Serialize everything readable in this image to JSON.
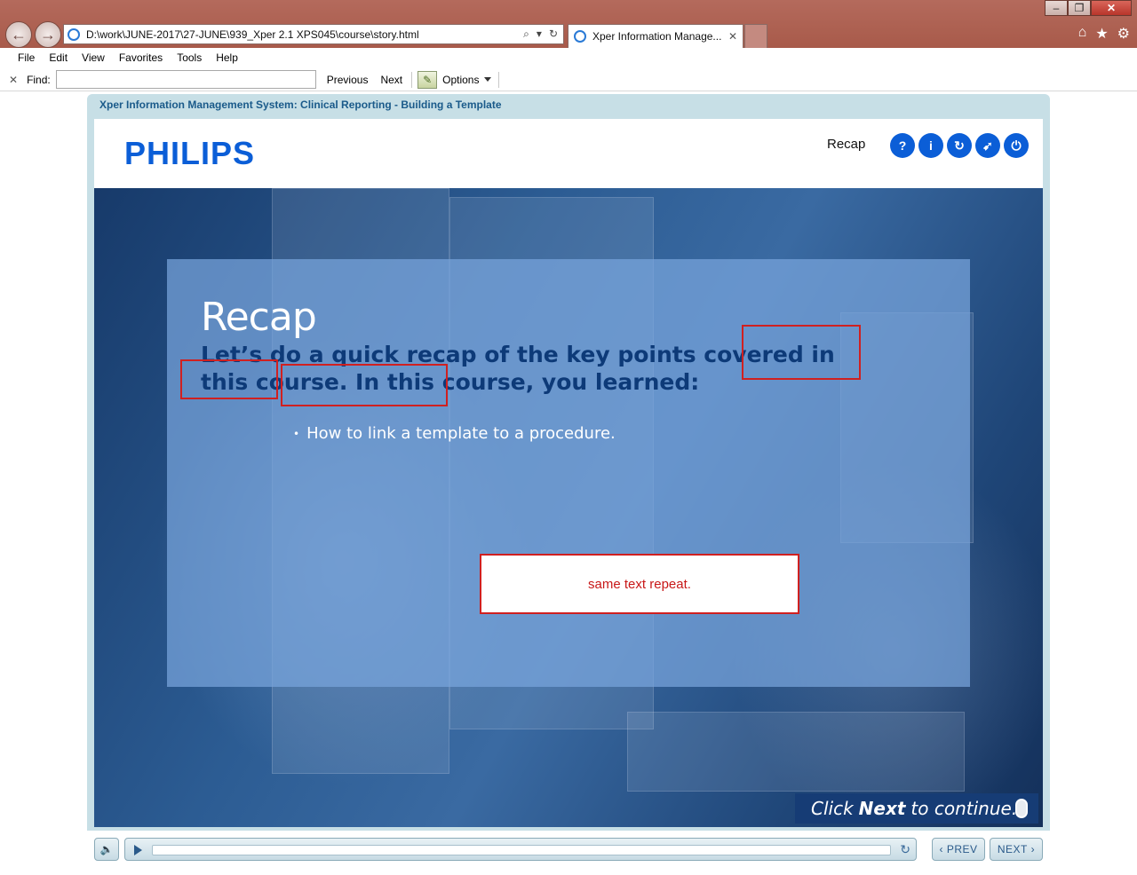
{
  "browser": {
    "address": "D:\\work\\JUNE-2017\\27-JUNE\\939_Xper 2.1 XPS045\\course\\story.html",
    "tab_title": "Xper Information Manage...",
    "menu": [
      "File",
      "Edit",
      "View",
      "Favorites",
      "Tools",
      "Help"
    ],
    "find": {
      "label": "Find:",
      "value": "",
      "previous_label": "Previous",
      "next_label": "Next",
      "options_label": "Options"
    }
  },
  "course": {
    "title": "Xper Information Management System: Clinical Reporting - Building a Template",
    "logo": "PHILIPS",
    "header_label": "Recap",
    "header_icons": [
      "help-icon",
      "info-icon",
      "refresh-icon",
      "compass-icon",
      "power-icon"
    ],
    "slide": {
      "title": "Recap",
      "heading": "Let’s do a quick recap of the key points covered in this course. In this course, you learned:",
      "bullets": [
        "How to link a template to a procedure."
      ]
    },
    "review_comment": "same text repeat.",
    "continue": {
      "prefix": "Click",
      "bold": "Next",
      "suffix": "to continue."
    }
  },
  "controls": {
    "prev_label": "PREV",
    "next_label": "NEXT",
    "progress": 0
  },
  "colors": {
    "brand": "#0b5ed7",
    "heading": "#0d3a78",
    "review_red": "#d02020"
  }
}
